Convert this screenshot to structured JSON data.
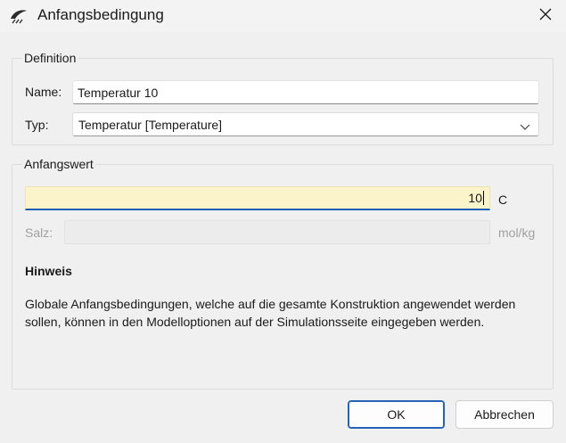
{
  "window": {
    "title": "Anfangsbedingung",
    "icon": "app-logo-icon",
    "close_icon": "close-icon"
  },
  "definition": {
    "group_title": "Definition",
    "name_label": "Name:",
    "name_value": "Temperatur 10",
    "type_label": "Typ:",
    "type_value": "Temperatur [Temperature]"
  },
  "initial_value": {
    "group_title": "Anfangswert",
    "value": "10",
    "unit": "C",
    "salt_label": "Salz:",
    "salt_unit": "mol/kg"
  },
  "hint": {
    "title": "Hinweis",
    "text": "Globale Anfangsbedingungen, welche auf die gesamte Konstruktion angewendet werden sollen, können in den Modelloptionen auf der Simulationsseite eingegeben werden."
  },
  "buttons": {
    "ok": "OK",
    "cancel": "Abbrechen"
  },
  "colors": {
    "accent": "#1a5fb4",
    "highlight_field": "#fbf3c9"
  }
}
